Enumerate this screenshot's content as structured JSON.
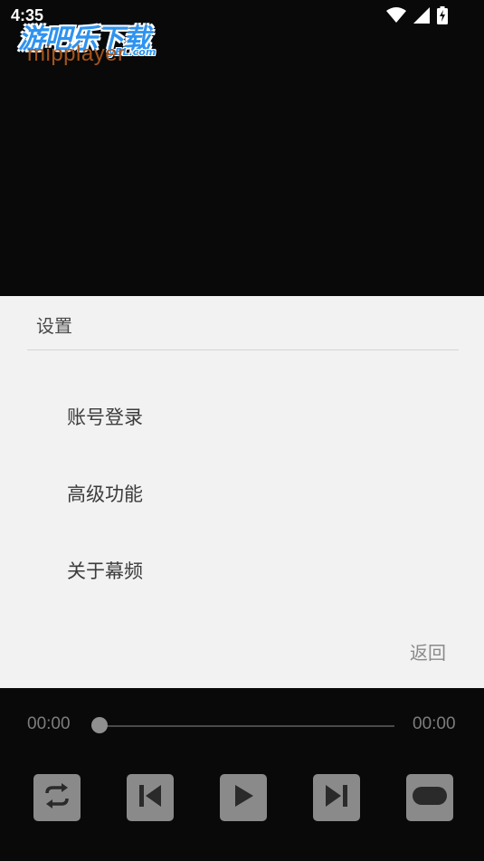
{
  "status_bar": {
    "time": "4:35",
    "icons": [
      "wifi-icon",
      "cell-signal-icon",
      "battery-charging-icon"
    ]
  },
  "watermark": {
    "text": "游吧乐下载",
    "sub": "yBL.com"
  },
  "app": {
    "logo_text": "mipplayer"
  },
  "dialog": {
    "title": "设置",
    "items": [
      {
        "label": "账号登录"
      },
      {
        "label": "高级功能"
      },
      {
        "label": "关于幕频"
      }
    ],
    "back_label": "返回"
  },
  "player": {
    "current_time": "00:00",
    "total_time": "00:00",
    "progress": 0,
    "controls": [
      "repeat-icon",
      "skip-previous-icon",
      "play-icon",
      "skip-next-icon",
      "toggle-pill-icon"
    ]
  },
  "colors": {
    "background": "#090909",
    "dialog_bg": "#f2f2f2",
    "button_gray": "#8a8a8a",
    "watermark_blue": "#2e93f0",
    "logo_orange": "#a6541c"
  }
}
